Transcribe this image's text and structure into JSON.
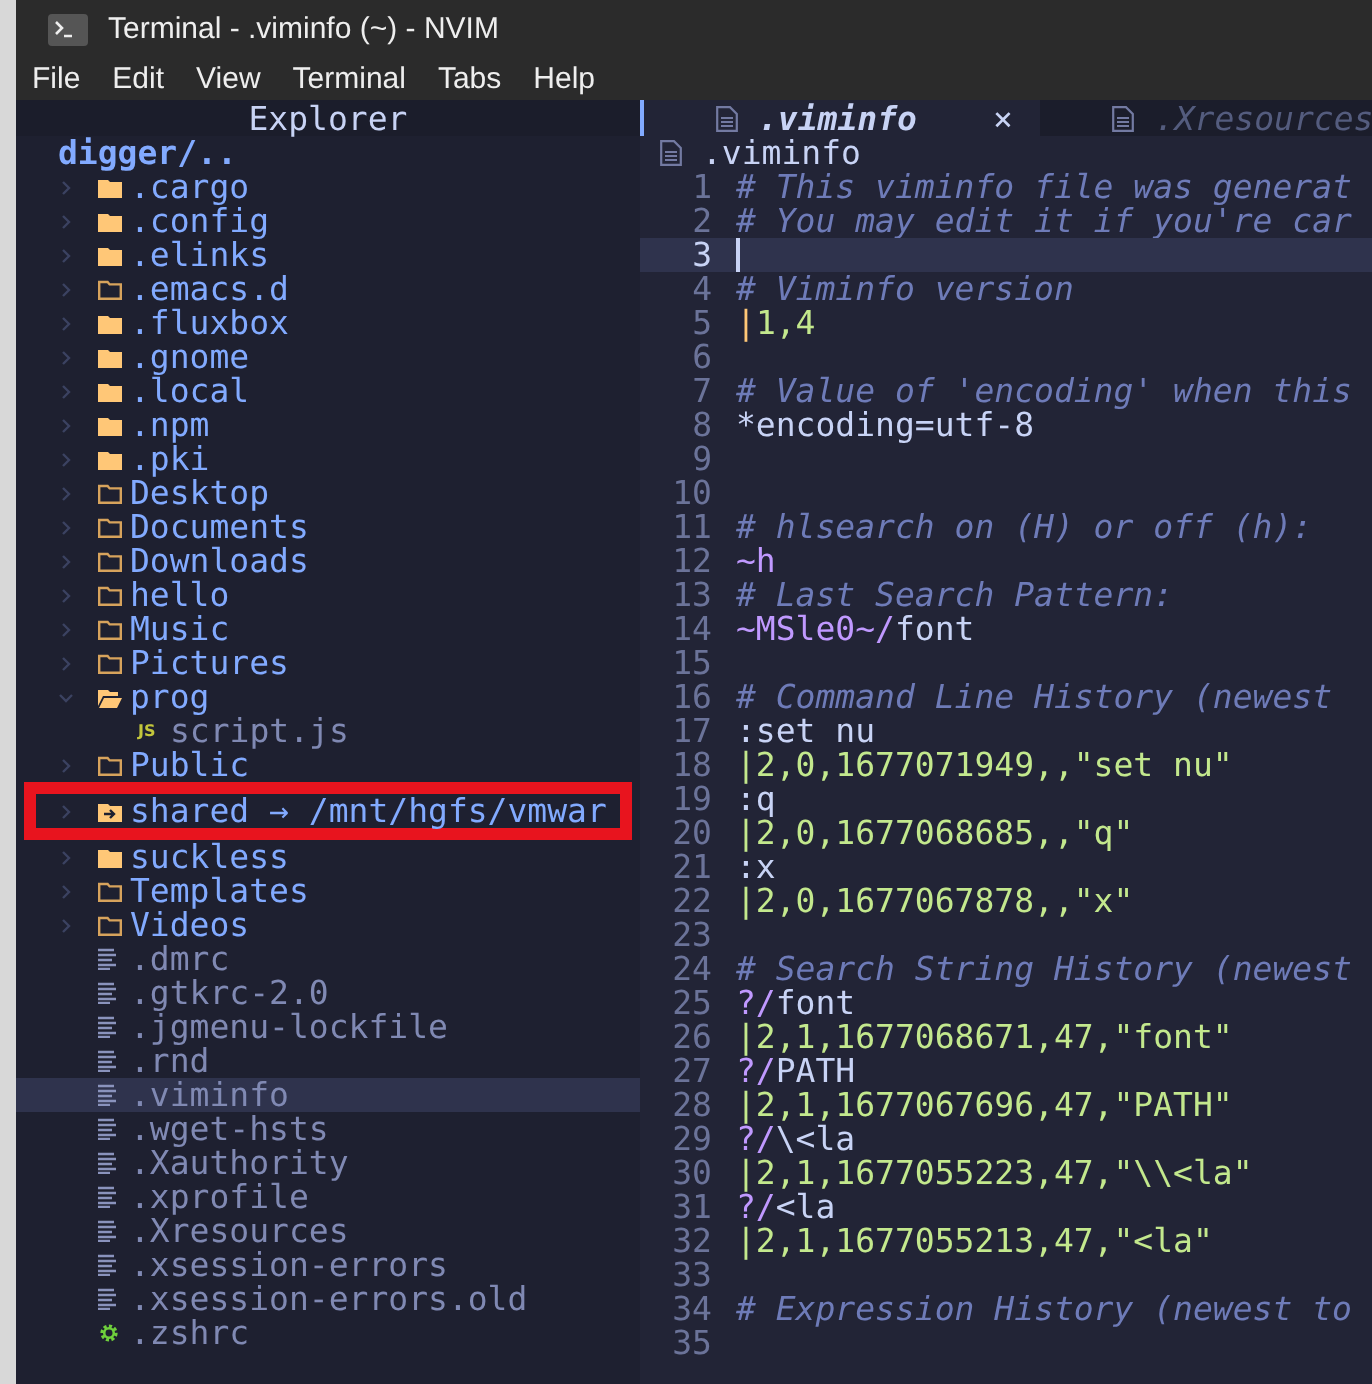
{
  "window": {
    "title": "Terminal - .viminfo (~) - NVIM"
  },
  "menu": [
    "File",
    "Edit",
    "View",
    "Terminal",
    "Tabs",
    "Help"
  ],
  "explorer": {
    "title": "Explorer",
    "root": "digger/..",
    "items": [
      {
        "name": ".cargo",
        "kind": "folder_filled",
        "expanded": false,
        "selected": false,
        "boxed": false
      },
      {
        "name": ".config",
        "kind": "folder_filled",
        "expanded": false,
        "selected": false,
        "boxed": false
      },
      {
        "name": ".elinks",
        "kind": "folder_filled",
        "expanded": false,
        "selected": false,
        "boxed": false
      },
      {
        "name": ".emacs.d",
        "kind": "folder_outline",
        "expanded": false,
        "selected": false,
        "boxed": false
      },
      {
        "name": ".fluxbox",
        "kind": "folder_filled",
        "expanded": false,
        "selected": false,
        "boxed": false
      },
      {
        "name": ".gnome",
        "kind": "folder_filled",
        "expanded": false,
        "selected": false,
        "boxed": false
      },
      {
        "name": ".local",
        "kind": "folder_filled",
        "expanded": false,
        "selected": false,
        "boxed": false
      },
      {
        "name": ".npm",
        "kind": "folder_filled",
        "expanded": false,
        "selected": false,
        "boxed": false
      },
      {
        "name": ".pki",
        "kind": "folder_filled",
        "expanded": false,
        "selected": false,
        "boxed": false
      },
      {
        "name": "Desktop",
        "kind": "folder_outline",
        "expanded": false,
        "selected": false,
        "boxed": false
      },
      {
        "name": "Documents",
        "kind": "folder_outline",
        "expanded": false,
        "selected": false,
        "boxed": false
      },
      {
        "name": "Downloads",
        "kind": "folder_outline",
        "expanded": false,
        "selected": false,
        "boxed": false
      },
      {
        "name": "hello",
        "kind": "folder_outline",
        "expanded": false,
        "selected": false,
        "boxed": false
      },
      {
        "name": "Music",
        "kind": "folder_outline",
        "expanded": false,
        "selected": false,
        "boxed": false
      },
      {
        "name": "Pictures",
        "kind": "folder_outline",
        "expanded": false,
        "selected": false,
        "boxed": false
      },
      {
        "name": "prog",
        "kind": "folder_outline",
        "expanded": true,
        "selected": false,
        "boxed": false,
        "children": [
          {
            "name": "script.js",
            "kind": "js",
            "badge": "JS",
            "selected": false,
            "boxed": false
          }
        ]
      },
      {
        "name": "Public",
        "kind": "folder_outline",
        "expanded": false,
        "selected": false,
        "boxed": false
      },
      {
        "name": "shared → /mnt/hgfs/vmwar",
        "kind": "folder_link",
        "expanded": false,
        "selected": false,
        "boxed": true
      },
      {
        "name": "suckless",
        "kind": "folder_filled",
        "expanded": false,
        "selected": false,
        "boxed": false
      },
      {
        "name": "Templates",
        "kind": "folder_outline",
        "expanded": false,
        "selected": false,
        "boxed": false
      },
      {
        "name": "Videos",
        "kind": "folder_outline",
        "expanded": false,
        "selected": false,
        "boxed": false
      },
      {
        "name": ".dmrc",
        "kind": "file",
        "selected": false,
        "boxed": false
      },
      {
        "name": ".gtkrc-2.0",
        "kind": "file",
        "selected": false,
        "boxed": false
      },
      {
        "name": ".jgmenu-lockfile",
        "kind": "file",
        "selected": false,
        "boxed": false
      },
      {
        "name": ".rnd",
        "kind": "file",
        "selected": false,
        "boxed": false
      },
      {
        "name": ".viminfo",
        "kind": "file",
        "selected": true,
        "boxed": false
      },
      {
        "name": ".wget-hsts",
        "kind": "file",
        "selected": false,
        "boxed": false
      },
      {
        "name": ".Xauthority",
        "kind": "file",
        "selected": false,
        "boxed": false
      },
      {
        "name": ".xprofile",
        "kind": "file",
        "selected": false,
        "boxed": false
      },
      {
        "name": ".Xresources",
        "kind": "file",
        "selected": false,
        "boxed": false
      },
      {
        "name": ".xsession-errors",
        "kind": "file",
        "selected": false,
        "boxed": false
      },
      {
        "name": ".xsession-errors.old",
        "kind": "file",
        "selected": false,
        "boxed": false
      },
      {
        "name": ".zshrc",
        "kind": "config",
        "selected": false,
        "boxed": false
      }
    ]
  },
  "tabs": [
    {
      "label": ".viminfo",
      "selected": true,
      "close": "×"
    },
    {
      "label": ".Xresources",
      "selected": false
    }
  ],
  "editor": {
    "breadcrumb": ".viminfo",
    "lines": [
      {
        "number": "1",
        "current": false,
        "segments": [
          {
            "text": "# This viminfo file was generat",
            "kind": "comment"
          }
        ]
      },
      {
        "number": "2",
        "current": false,
        "segments": [
          {
            "text": "# You may edit it if you're car",
            "kind": "comment"
          }
        ]
      },
      {
        "number": "3",
        "current": true
      },
      {
        "number": "4",
        "current": false,
        "segments": [
          {
            "text": "# Viminfo version",
            "kind": "comment"
          }
        ]
      },
      {
        "number": "5",
        "current": false,
        "segments": [
          {
            "text": "|",
            "kind": "yellow"
          },
          {
            "text": "1,4",
            "kind": "green"
          }
        ]
      },
      {
        "number": "6",
        "current": false
      },
      {
        "number": "7",
        "current": false,
        "segments": [
          {
            "text": "# Value of 'encoding' when this",
            "kind": "comment"
          }
        ]
      },
      {
        "number": "8",
        "current": false,
        "segments": [
          {
            "text": "*encoding=utf-8",
            "kind": "plain"
          }
        ]
      },
      {
        "number": "9",
        "current": false
      },
      {
        "number": "10",
        "current": false
      },
      {
        "number": "11",
        "current": false,
        "segments": [
          {
            "text": "# hlsearch on (H) or off (h):",
            "kind": "comment"
          }
        ]
      },
      {
        "number": "12",
        "current": false,
        "segments": [
          {
            "text": "~h",
            "kind": "purple"
          }
        ]
      },
      {
        "number": "13",
        "current": false,
        "segments": [
          {
            "text": "# Last Search Pattern:",
            "kind": "comment"
          }
        ]
      },
      {
        "number": "14",
        "current": false,
        "segments": [
          {
            "text": "~MSle0~/",
            "kind": "purple"
          },
          {
            "text": "font",
            "kind": "plain"
          }
        ]
      },
      {
        "number": "15",
        "current": false
      },
      {
        "number": "16",
        "current": false,
        "segments": [
          {
            "text": "# Command Line History (newest",
            "kind": "comment"
          }
        ]
      },
      {
        "number": "17",
        "current": false,
        "segments": [
          {
            "text": ":set nu",
            "kind": "plain"
          }
        ]
      },
      {
        "number": "18",
        "current": false,
        "segments": [
          {
            "text": "|2,0,1677071949,,\"set nu\"",
            "kind": "green"
          }
        ]
      },
      {
        "number": "19",
        "current": false,
        "segments": [
          {
            "text": ":q",
            "kind": "plain"
          }
        ]
      },
      {
        "number": "20",
        "current": false,
        "segments": [
          {
            "text": "|2,0,1677068685,,\"q\"",
            "kind": "green"
          }
        ]
      },
      {
        "number": "21",
        "current": false,
        "segments": [
          {
            "text": ":x",
            "kind": "plain"
          }
        ]
      },
      {
        "number": "22",
        "current": false,
        "segments": [
          {
            "text": "|2,0,1677067878,,\"x\"",
            "kind": "green"
          }
        ]
      },
      {
        "number": "23",
        "current": false
      },
      {
        "number": "24",
        "current": false,
        "segments": [
          {
            "text": "# Search String History (newest",
            "kind": "comment"
          }
        ]
      },
      {
        "number": "25",
        "current": false,
        "segments": [
          {
            "text": "?/",
            "kind": "purple"
          },
          {
            "text": "font",
            "kind": "plain"
          }
        ]
      },
      {
        "number": "26",
        "current": false,
        "segments": [
          {
            "text": "|2,1,1677068671,47,\"font\"",
            "kind": "green"
          }
        ]
      },
      {
        "number": "27",
        "current": false,
        "segments": [
          {
            "text": "?/",
            "kind": "purple"
          },
          {
            "text": "PATH",
            "kind": "plain"
          }
        ]
      },
      {
        "number": "28",
        "current": false,
        "segments": [
          {
            "text": "|2,1,1677067696,47,\"PATH\"",
            "kind": "green"
          }
        ]
      },
      {
        "number": "29",
        "current": false,
        "segments": [
          {
            "text": "?/",
            "kind": "purple"
          },
          {
            "text": "\\<la",
            "kind": "plain"
          }
        ]
      },
      {
        "number": "30",
        "current": false,
        "segments": [
          {
            "text": "|2,1,1677055223,47,\"\\\\<la\"",
            "kind": "green"
          }
        ]
      },
      {
        "number": "31",
        "current": false,
        "segments": [
          {
            "text": "?/",
            "kind": "purple"
          },
          {
            "text": "<la",
            "kind": "plain"
          }
        ]
      },
      {
        "number": "32",
        "current": false,
        "segments": [
          {
            "text": "|2,1,1677055213,47,\"<la\"",
            "kind": "green"
          }
        ]
      },
      {
        "number": "33",
        "current": false
      },
      {
        "number": "34",
        "current": false,
        "segments": [
          {
            "text": "# Expression History (newest to",
            "kind": "comment"
          }
        ]
      },
      {
        "number": "35",
        "current": false
      }
    ]
  }
}
